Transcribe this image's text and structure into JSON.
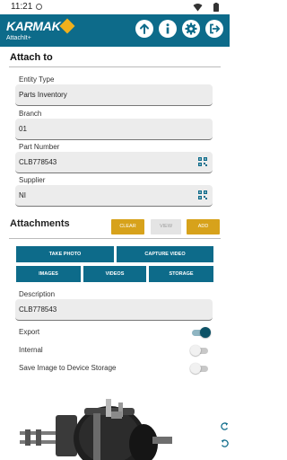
{
  "status_bar": {
    "time": "11:21"
  },
  "app_bar": {
    "brand": "KARMAK",
    "subtitle": "AttachIt+",
    "colors": {
      "bar": "#0d6b8a",
      "accent": "#f0b01c"
    },
    "actions": [
      "upload-icon",
      "info-icon",
      "gear-icon",
      "logout-icon"
    ]
  },
  "attach_to": {
    "title": "Attach to",
    "entity_type": {
      "label": "Entity Type",
      "value": "Parts Inventory"
    },
    "branch": {
      "label": "Branch",
      "value": "01"
    },
    "part_number": {
      "label": "Part Number",
      "value": "CLB778543"
    },
    "supplier": {
      "label": "Supplier",
      "value": "NI"
    }
  },
  "attachments": {
    "title": "Attachments",
    "clear_label": "CLEAR",
    "view_label": "VIEW",
    "add_label": "ADD",
    "take_photo_label": "TAKE PHOTO",
    "capture_video_label": "CAPTURE VIDEO",
    "images_label": "IMAGES",
    "videos_label": "VIDEOS",
    "storage_label": "STORAGE"
  },
  "description": {
    "label": "Description",
    "value": "CLB778543"
  },
  "options": {
    "export": {
      "label": "Export",
      "on": true
    },
    "internal": {
      "label": "Internal",
      "on": false
    },
    "save_to_device": {
      "label": "Save Image to Device Storage",
      "on": false
    }
  },
  "side_icons": [
    "rotate-left-icon",
    "rotate-right-icon"
  ]
}
